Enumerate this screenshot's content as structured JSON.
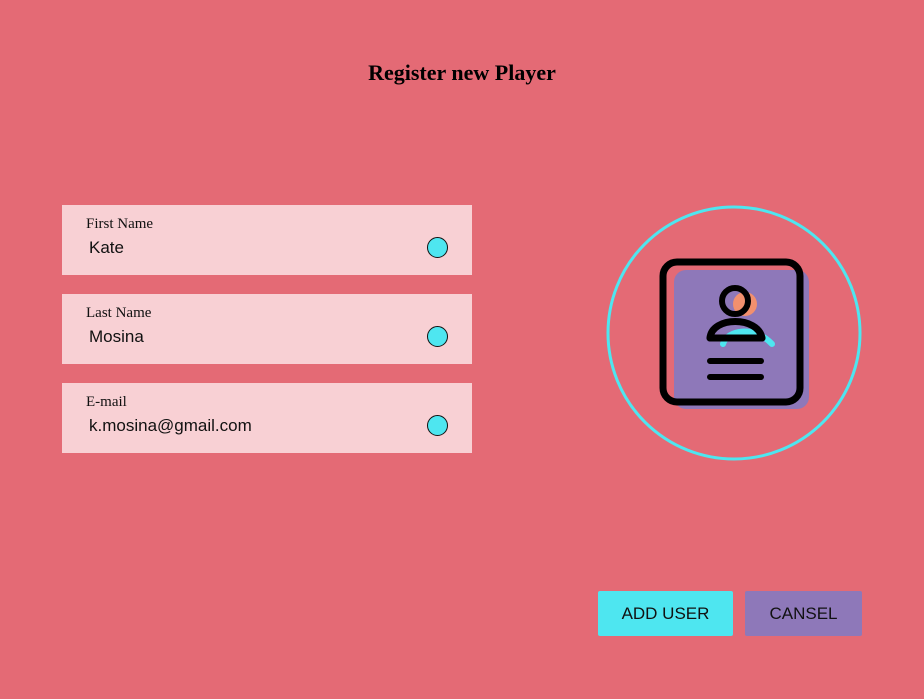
{
  "page": {
    "title": "Register new Player"
  },
  "form": {
    "first_name": {
      "label": "First Name",
      "value": "Kate"
    },
    "last_name": {
      "label": "Last Name",
      "value": "Mosina"
    },
    "email": {
      "label": "E-mail",
      "value": "k.mosina@gmail.com"
    }
  },
  "avatar": {
    "icon": "user-profile-card-icon"
  },
  "actions": {
    "add_label": "ADD USER",
    "cancel_label": "CANSEL"
  },
  "colors": {
    "background": "#e46a75",
    "field_bg": "#f8d0d4",
    "accent_cyan": "#4ee6f0",
    "accent_purple": "#8e78b9",
    "accent_orange": "#f2906e"
  }
}
